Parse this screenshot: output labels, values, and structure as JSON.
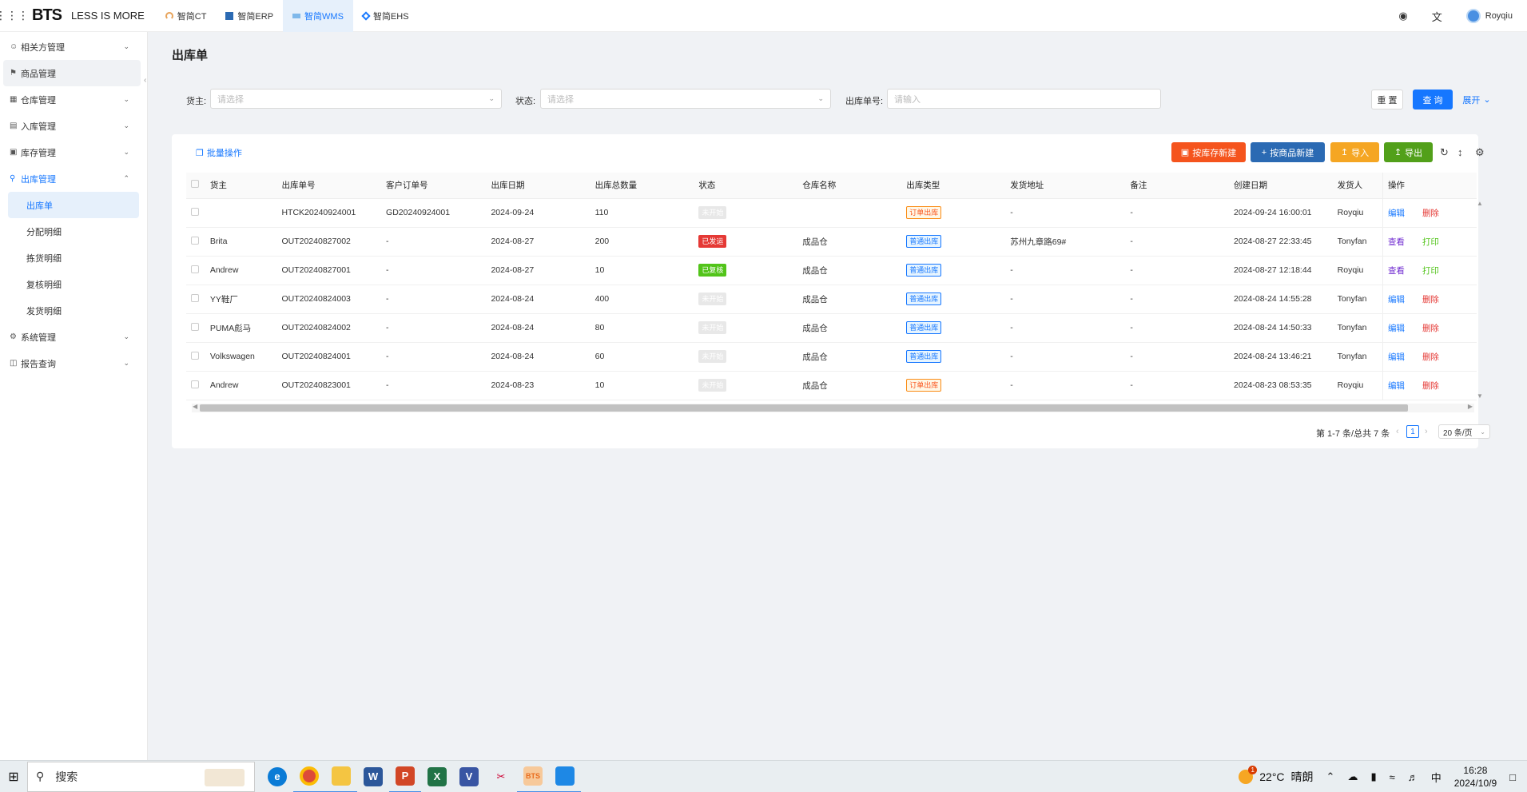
{
  "topbar": {
    "brand": "BTS",
    "slogan": "LESS IS MORE",
    "apps": [
      {
        "label": "智简CT",
        "active": false
      },
      {
        "label": "智简ERP",
        "active": false
      },
      {
        "label": "智简WMS",
        "active": true
      },
      {
        "label": "智简EHS",
        "active": false
      }
    ],
    "user": "Royqiu"
  },
  "sidebar": {
    "items": [
      {
        "label": "相关方管理",
        "icon": "user-icon"
      },
      {
        "label": "商品管理",
        "icon": "goods-icon"
      },
      {
        "label": "仓库管理",
        "icon": "warehouse-icon"
      },
      {
        "label": "入库管理",
        "icon": "inbound-icon"
      },
      {
        "label": "库存管理",
        "icon": "inventory-icon"
      },
      {
        "label": "出库管理",
        "icon": "outbound-icon"
      }
    ],
    "subitems": [
      "出库单",
      "分配明细",
      "拣货明细",
      "复核明细",
      "发货明细"
    ],
    "bottom_items": [
      {
        "label": "系统管理",
        "icon": "settings-icon"
      },
      {
        "label": "报告查询",
        "icon": "report-icon"
      }
    ]
  },
  "page": {
    "title": "出库单"
  },
  "filters": {
    "owner_label": "货主:",
    "owner_placeholder": "请选择",
    "status_label": "状态:",
    "status_placeholder": "请选择",
    "order_label": "出库单号:",
    "order_placeholder": "请输入",
    "reset": "重 置",
    "query": "查 询",
    "expand": "展开"
  },
  "toolbar": {
    "batch": "批量操作",
    "by_stock": "按库存新建",
    "by_goods": "按商品新建",
    "import": "导入",
    "export": "导出"
  },
  "table": {
    "headers": [
      "货主",
      "出库单号",
      "客户订单号",
      "出库日期",
      "出库总数量",
      "状态",
      "仓库名称",
      "出库类型",
      "发货地址",
      "备注",
      "创建日期",
      "发货人",
      "操作"
    ],
    "rows": [
      {
        "owner": "",
        "no": "HTCK20240924001",
        "cust": "GD20240924001",
        "date": "2024-09-24",
        "qty": "110",
        "status": "未开始",
        "status_cls": "tag-gray",
        "wh": "",
        "type": "订单出库",
        "type_cls": "tag-orange",
        "addr": "-",
        "note": "-",
        "created": "2024-09-24 16:00:01",
        "shipper": "Royqiu",
        "op1": "编辑",
        "op1_cls": "lnk-blue",
        "op2": "删除",
        "op2_cls": "lnk-red"
      },
      {
        "owner": "Brita",
        "no": "OUT20240827002",
        "cust": "-",
        "date": "2024-08-27",
        "qty": "200",
        "status": "已发运",
        "status_cls": "tag-red-solid",
        "wh": "成品仓",
        "type": "普通出库",
        "type_cls": "tag-blue",
        "addr": "苏州九章路69#",
        "note": "-",
        "created": "2024-08-27 22:33:45",
        "shipper": "Tonyfan",
        "op1": "查看",
        "op1_cls": "lnk-purple",
        "op2": "打印",
        "op2_cls": "lnk-green"
      },
      {
        "owner": "Andrew",
        "no": "OUT20240827001",
        "cust": "-",
        "date": "2024-08-27",
        "qty": "10",
        "status": "已复核",
        "status_cls": "tag-green-solid",
        "wh": "成品仓",
        "type": "普通出库",
        "type_cls": "tag-blue",
        "addr": "-",
        "note": "-",
        "created": "2024-08-27 12:18:44",
        "shipper": "Royqiu",
        "op1": "查看",
        "op1_cls": "lnk-purple",
        "op2": "打印",
        "op2_cls": "lnk-green"
      },
      {
        "owner": "YY鞋厂",
        "no": "OUT20240824003",
        "cust": "-",
        "date": "2024-08-24",
        "qty": "400",
        "status": "未开始",
        "status_cls": "tag-gray",
        "wh": "成品仓",
        "type": "普通出库",
        "type_cls": "tag-blue",
        "addr": "-",
        "note": "-",
        "created": "2024-08-24 14:55:28",
        "shipper": "Tonyfan",
        "op1": "编辑",
        "op1_cls": "lnk-blue",
        "op2": "删除",
        "op2_cls": "lnk-red"
      },
      {
        "owner": "PUMA彪马",
        "no": "OUT20240824002",
        "cust": "-",
        "date": "2024-08-24",
        "qty": "80",
        "status": "未开始",
        "status_cls": "tag-gray",
        "wh": "成品仓",
        "type": "普通出库",
        "type_cls": "tag-blue",
        "addr": "-",
        "note": "-",
        "created": "2024-08-24 14:50:33",
        "shipper": "Tonyfan",
        "op1": "编辑",
        "op1_cls": "lnk-blue",
        "op2": "删除",
        "op2_cls": "lnk-red"
      },
      {
        "owner": "Volkswagen",
        "no": "OUT20240824001",
        "cust": "-",
        "date": "2024-08-24",
        "qty": "60",
        "status": "未开始",
        "status_cls": "tag-gray",
        "wh": "成品仓",
        "type": "普通出库",
        "type_cls": "tag-blue",
        "addr": "-",
        "note": "-",
        "created": "2024-08-24 13:46:21",
        "shipper": "Tonyfan",
        "op1": "编辑",
        "op1_cls": "lnk-blue",
        "op2": "删除",
        "op2_cls": "lnk-red"
      },
      {
        "owner": "Andrew",
        "no": "OUT20240823001",
        "cust": "-",
        "date": "2024-08-23",
        "qty": "10",
        "status": "未开始",
        "status_cls": "tag-gray",
        "wh": "成品仓",
        "type": "订单出库",
        "type_cls": "tag-orange",
        "addr": "-",
        "note": "-",
        "created": "2024-08-23 08:53:35",
        "shipper": "Royqiu",
        "op1": "编辑",
        "op1_cls": "lnk-blue",
        "op2": "删除",
        "op2_cls": "lnk-red"
      }
    ]
  },
  "pagination": {
    "summary": "第 1-7 条/总共 7 条",
    "current": "1",
    "page_size": "20 条/页"
  },
  "taskbar": {
    "search": "搜索",
    "temp": "22°C",
    "weather": "晴朗",
    "ime": "中",
    "time": "16:28",
    "date": "2024/10/9",
    "badge": "1"
  },
  "colors": {
    "primary": "#1677ff",
    "orange_btn": "#f5541d",
    "blue_btn": "#2b6ab3",
    "yellow_btn": "#f5a623",
    "green_btn": "#52a01a"
  }
}
